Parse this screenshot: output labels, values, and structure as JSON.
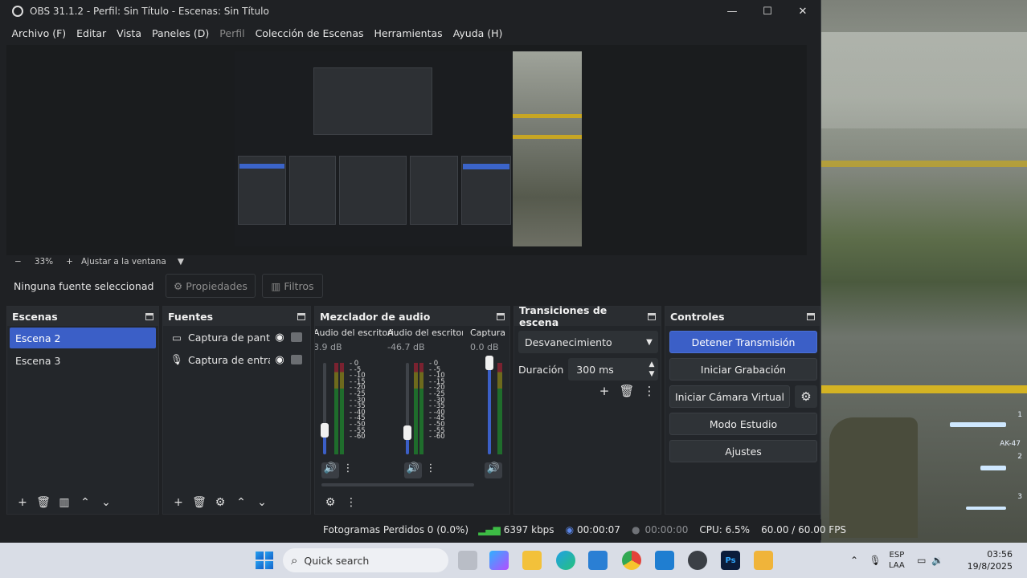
{
  "window": {
    "title": "OBS 31.1.2 - Perfil: Sin Título - Escenas: Sin Título",
    "controls": {
      "minimize": "—",
      "maximize": "☐",
      "close": "✕"
    }
  },
  "menu": [
    "Archivo (F)",
    "Editar",
    "Vista",
    "Paneles (D)",
    "Perfil",
    "Colección de Escenas",
    "Herramientas",
    "Ayuda (H)"
  ],
  "zoom": {
    "minus": "−",
    "value": "33%",
    "plus": "+",
    "fit": "Ajustar a la ventana",
    "caret": "▼"
  },
  "source_toolbar": {
    "none_selected": "Ninguna fuente seleccionad",
    "properties": "Propiedades",
    "filters": "Filtros"
  },
  "docks": {
    "scenes": {
      "title": "Escenas",
      "items": [
        "Escena 2",
        "Escena 3"
      ],
      "selected": "Escena 2"
    },
    "sources": {
      "title": "Fuentes",
      "items": [
        "Captura de pantalla",
        "Captura de entrada"
      ]
    },
    "mixer": {
      "title": "Mezclador de audio",
      "channels": [
        {
          "name": "Audio del escritorio",
          "db": "3.9 dB",
          "level": 0.26
        },
        {
          "name": "Audio del escritorio",
          "db": "-46.7 dB",
          "level": 0.24
        },
        {
          "name": "Captura d",
          "db": "0.0 dB",
          "level": 1.0
        }
      ],
      "scale": [
        "0",
        "-5",
        "-10",
        "-15",
        "-20",
        "-25",
        "-30",
        "-35",
        "-40",
        "-45",
        "-50",
        "-55",
        "-60"
      ]
    },
    "transitions": {
      "title": "Transiciones de escena",
      "selected": "Desvanecimiento",
      "duration_label": "Duración",
      "duration_value": "300 ms"
    },
    "controls": {
      "title": "Controles",
      "stop_stream": "Detener Transmisión",
      "start_recording": "Iniciar Grabación",
      "start_virtualcam": "Iniciar Cámara Virtual",
      "studio_mode": "Modo Estudio",
      "settings": "Ajustes"
    }
  },
  "status": {
    "dropped_frames": "Fotogramas Perdidos 0 (0.0%)",
    "bitrate": "6397 kbps",
    "stream_time": "00:00:07",
    "rec_time": "00:00:00",
    "cpu": "CPU: 6.5%",
    "fps": "60.00 / 60.00 FPS"
  },
  "game_hud": {
    "slot1": "1",
    "weapon1": "AK-47",
    "slot2": "2",
    "slot3": "3"
  },
  "taskbar": {
    "search_placeholder": "Quick search",
    "apps": [
      "explorer",
      "edge",
      "store",
      "chrome",
      "vscode",
      "obs",
      "photoshop",
      "other"
    ],
    "ps_label": "Ps",
    "lang": "ESP",
    "lang2": "LAA",
    "time": "03:56",
    "date": "19/8/2025"
  },
  "colors": {
    "accent": "#3b5fc7",
    "panel": "#23262a",
    "background": "#1f2124"
  }
}
